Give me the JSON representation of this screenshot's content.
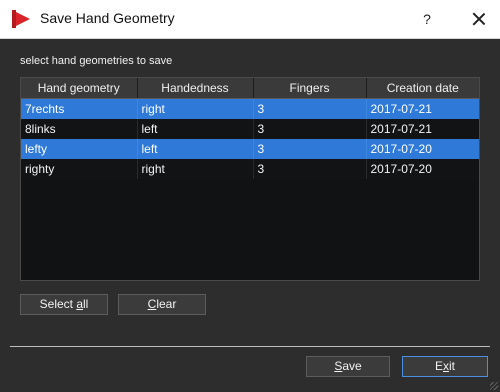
{
  "window": {
    "title": "Save Hand Geometry",
    "help_label": "?",
    "close_icon": "close-icon",
    "app_icon": "play-triangle-icon",
    "accent_color": "#d9252a"
  },
  "prompt": "select hand geometries to save",
  "table": {
    "headers": [
      "Hand geometry",
      "Handedness",
      "Fingers",
      "Creation date"
    ],
    "rows": [
      {
        "name": "7rechts",
        "handedness": "right",
        "fingers": "3",
        "date": "2017-07-21",
        "selected": true
      },
      {
        "name": "8links",
        "handedness": "left",
        "fingers": "3",
        "date": "2017-07-21",
        "selected": false
      },
      {
        "name": "lefty",
        "handedness": "left",
        "fingers": "3",
        "date": "2017-07-20",
        "selected": true
      },
      {
        "name": "righty",
        "handedness": "right",
        "fingers": "3",
        "date": "2017-07-20",
        "selected": false
      }
    ],
    "selection_color": "#2f7ad8"
  },
  "buttons": {
    "select_all": {
      "before": "Select ",
      "mnemonic": "a",
      "after": "ll"
    },
    "clear": {
      "before": "",
      "mnemonic": "C",
      "after": "lear"
    },
    "save": {
      "before": "",
      "mnemonic": "S",
      "after": "ave"
    },
    "exit": {
      "before": "E",
      "mnemonic": "x",
      "after": "it"
    }
  }
}
